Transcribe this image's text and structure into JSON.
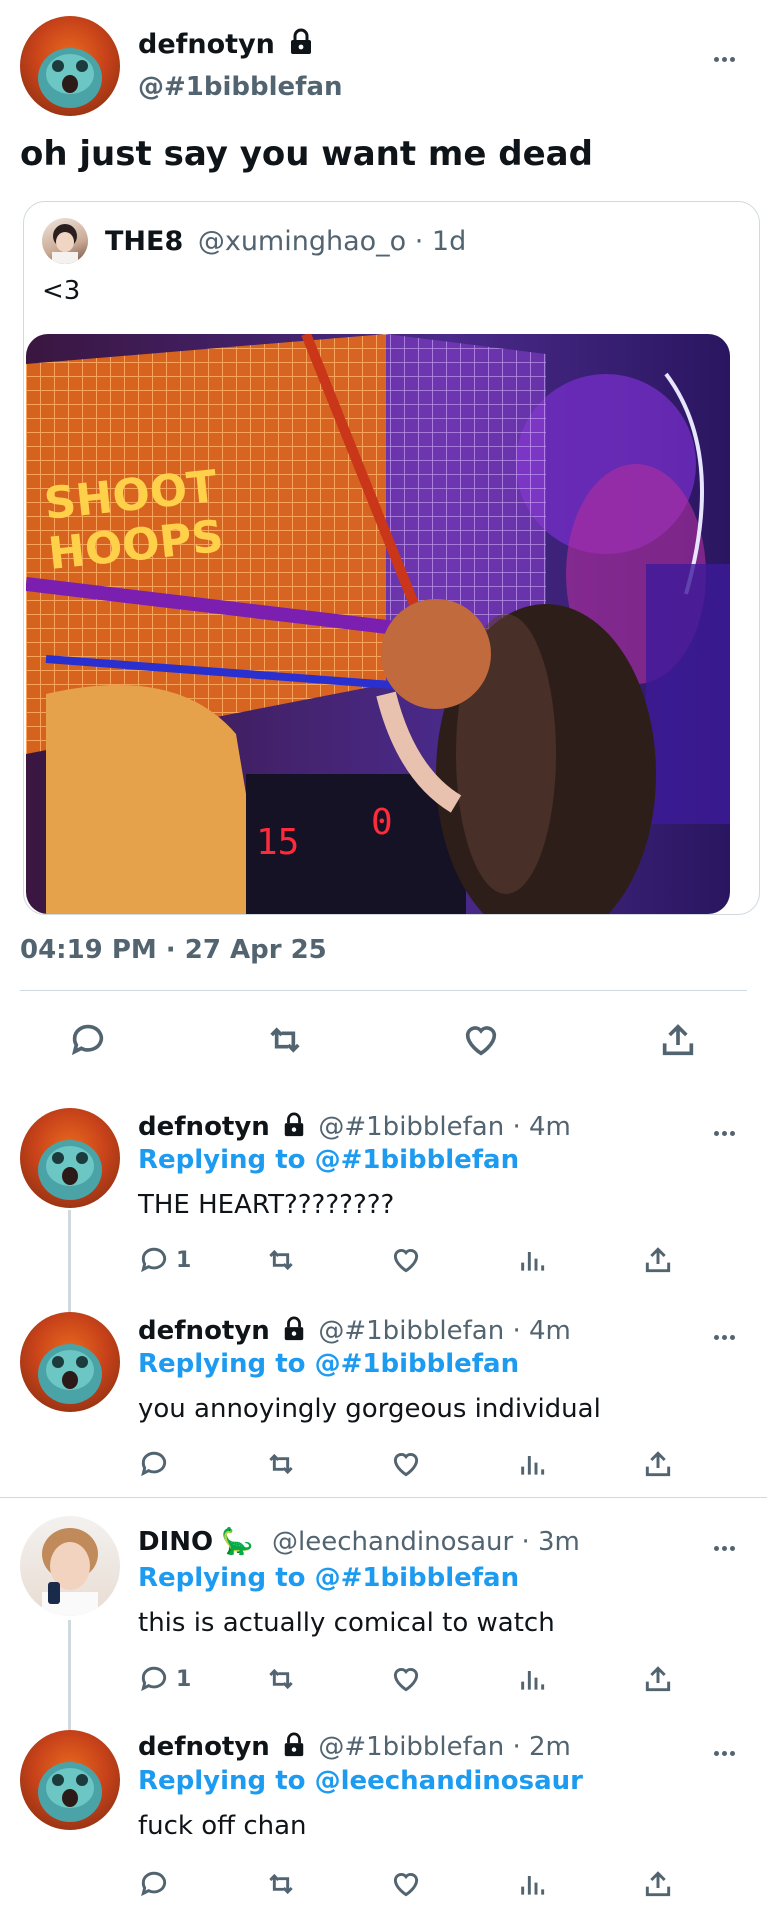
{
  "main": {
    "name": "defnotyn",
    "handle": "@#1bibblefan",
    "text": "oh just say you want me dead",
    "timestamp": "04:19 PM · 27 Apr 25"
  },
  "quote": {
    "name": "THE8",
    "meta": "@xuminghao_o · 1d",
    "text": "<3",
    "image_texts": [
      "SHOOT",
      "HOOPS",
      "15",
      "0"
    ]
  },
  "replies": [
    {
      "name": "defnotyn",
      "meta": "@#1bibblefan · 4m",
      "replying_label": "Replying to",
      "replying_to": "@#1bibblefan",
      "text": "THE HEART????????",
      "reply_count": "1"
    },
    {
      "name": "defnotyn",
      "meta": "@#1bibblefan · 4m",
      "replying_label": "Replying to",
      "replying_to": "@#1bibblefan",
      "text": "you annoyingly gorgeous individual",
      "reply_count": ""
    },
    {
      "name": "DINO",
      "emoji": "🦕",
      "meta": "@leechandinosaur · 3m",
      "replying_label": "Replying to",
      "replying_to": "@#1bibblefan",
      "text": "this is actually comical to watch",
      "reply_count": "1"
    },
    {
      "name": "defnotyn",
      "meta": "@#1bibblefan · 2m",
      "replying_label": "Replying to",
      "replying_to": "@leechandinosaur",
      "text": "fuck off chan",
      "reply_count": ""
    }
  ],
  "colors": {
    "accent": "#1d9bf0",
    "muted": "#536471",
    "text": "#0f1419"
  },
  "icons": [
    "reply-icon",
    "retweet-icon",
    "like-icon",
    "analytics-icon",
    "share-icon",
    "lock-icon",
    "more-icon"
  ]
}
